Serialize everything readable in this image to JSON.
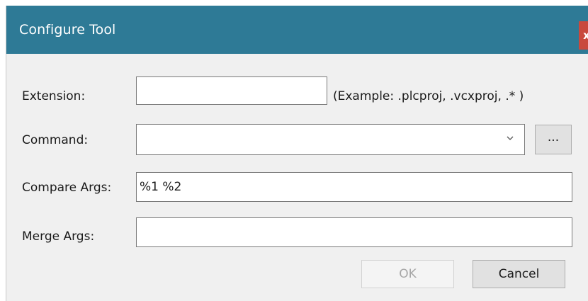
{
  "window": {
    "title": "Configure Tool",
    "close_label": "x"
  },
  "form": {
    "extension": {
      "label": "Extension:",
      "value": "",
      "hint": "(Example: .plcproj, .vcxproj, .* )"
    },
    "command": {
      "label": "Command:",
      "value": "",
      "browse_label": "..."
    },
    "compare_args": {
      "label": "Compare Args:",
      "value": "%1 %2"
    },
    "merge_args": {
      "label": "Merge Args:",
      "value": ""
    }
  },
  "buttons": {
    "ok_label": "OK",
    "ok_enabled": false,
    "cancel_label": "Cancel"
  },
  "colors": {
    "titlebar": "#2e7a96",
    "close_button": "#c9493d",
    "dialog_background": "#f0f0f0"
  }
}
